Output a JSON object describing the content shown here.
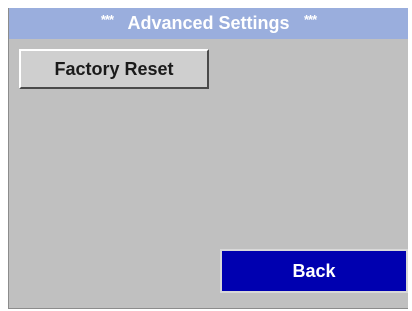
{
  "header": {
    "stars_left": "***",
    "title": "Advanced Settings",
    "stars_right": "***"
  },
  "buttons": {
    "factory_reset": "Factory Reset",
    "back": "Back"
  },
  "colors": {
    "title_bar": "#9aaedd",
    "panel": "#c0c0c0",
    "back_button": "#0000b0"
  }
}
